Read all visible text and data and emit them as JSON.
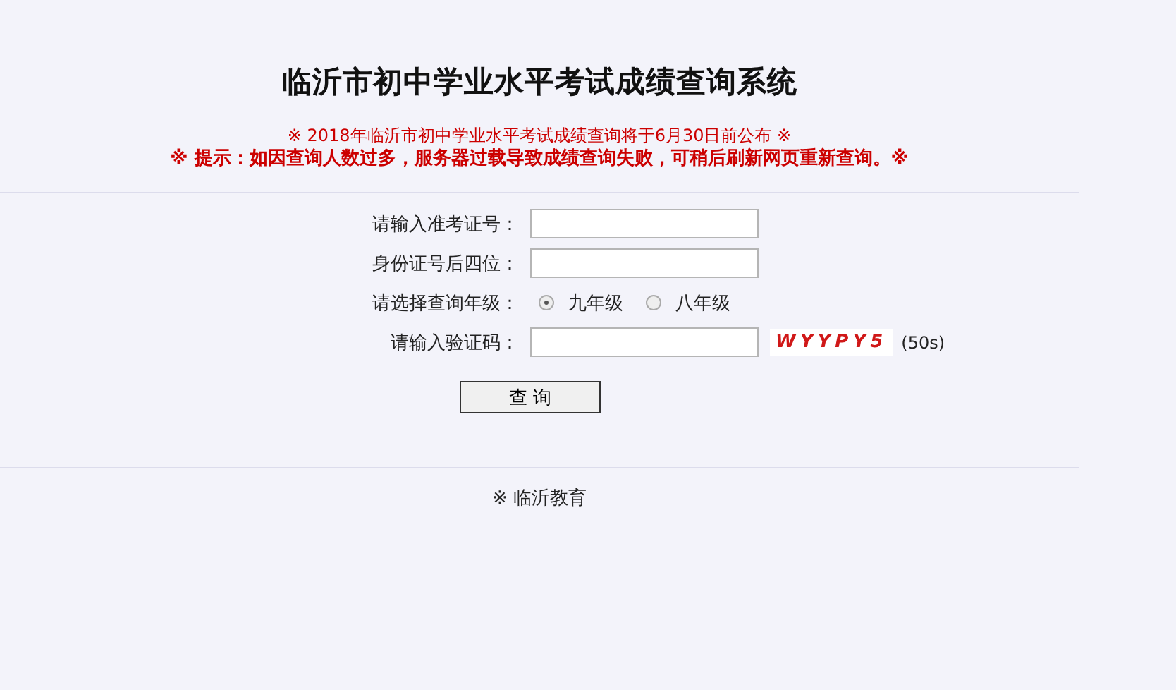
{
  "title": "临沂市初中学业水平考试成绩查询系统",
  "notice": "※ 2018年临沂市初中学业水平考试成绩查询将于6月30日前公布 ※",
  "warning": "※ 提示：如因查询人数过多，服务器过载导致成绩查询失败，可稍后刷新网页重新查询。※",
  "fields": [
    {
      "kind": "input",
      "label": "请输入准考证号："
    },
    {
      "kind": "input",
      "label": "身份证号后四位："
    },
    {
      "kind": "radio",
      "label": "请选择查询年级：",
      "options": [
        {
          "label": "九年级",
          "selected": true
        },
        {
          "label": "八年级",
          "selected": false
        }
      ]
    },
    {
      "kind": "captcha",
      "label": "请输入验证码：",
      "code": "WYYPY5",
      "timer": "(50s)"
    }
  ],
  "button": "查 询",
  "footer": "※ 临沂教育"
}
